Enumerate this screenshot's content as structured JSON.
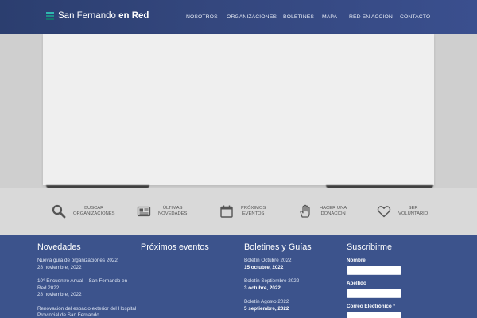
{
  "header": {
    "logo_regular": "San Fernando ",
    "logo_bold": "en Red",
    "nav": [
      {
        "label": "NOSOTROS"
      },
      {
        "label": "ORGANIZACIONES"
      },
      {
        "label": "BOLETINES"
      },
      {
        "label": "MAPA"
      },
      {
        "label": "RED EN ACCION"
      },
      {
        "label": "CONTACTO"
      }
    ]
  },
  "quick_links": [
    {
      "line1": "BUSCAR",
      "line2": "ORGANIZACIONES",
      "icon": "search-icon"
    },
    {
      "line1": "ÚLTIMAS",
      "line2": "NOVEDADES",
      "icon": "newspaper-icon"
    },
    {
      "line1": "PRÓXIMOS",
      "line2": "EVENTOS",
      "icon": "calendar-icon"
    },
    {
      "line1": "HACER UNA",
      "line2": "DONACIÓN",
      "icon": "hand-icon"
    },
    {
      "line1": "SER",
      "line2": "VOLUNTARIO",
      "icon": "heart-icon"
    }
  ],
  "footer": {
    "novedades": {
      "title": "Novedades",
      "items": [
        {
          "title": "Nueva guía de organizaciones 2022",
          "date": "28 noviembre, 2022"
        },
        {
          "title": "10° Encuentro Anual – San Fernando en Red 2022",
          "date": "28 noviembre, 2022"
        },
        {
          "title": "Renovación del espacio exterior del Hospital Provincial de San Fernando",
          "date": ""
        }
      ]
    },
    "eventos": {
      "title": "Próximos eventos"
    },
    "boletines": {
      "title": "Boletines y Guías",
      "items": [
        {
          "title": "Boletín Octubre 2022",
          "date": "15 octubre, 2022"
        },
        {
          "title": "Boletín Septiembre 2022",
          "date": "3 octubre, 2022"
        },
        {
          "title": "Boletín Agosto 2022",
          "date": "5 septiembre, 2022"
        }
      ]
    },
    "suscribirme": {
      "title": "Suscribirme",
      "nombre_label": "Nombre",
      "apellido_label": "Apellido",
      "correo_label": "Correo Electrónico *"
    }
  },
  "colors": {
    "header_bg": "#34477e",
    "footer_bg": "#3c538c",
    "accent_teal": "#2fb7b0"
  }
}
